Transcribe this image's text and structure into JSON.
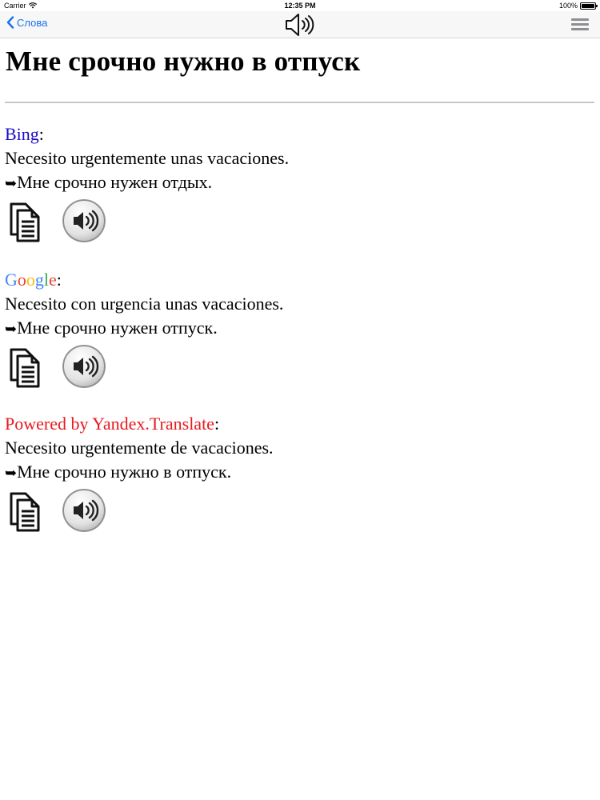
{
  "status": {
    "carrier": "Carrier",
    "time": "12:35 PM",
    "battery": "100%",
    "battery_level": 1.0
  },
  "nav": {
    "back_label": "Слова"
  },
  "page": {
    "title": "Мне срочно нужно в отпуск"
  },
  "arrow_glyph": "➥",
  "colon": ":",
  "sections": [
    {
      "provider": "Bing",
      "source": "Necesito urgentemente unas vacaciones.",
      "translation": "Мне срочно нужен отдых."
    },
    {
      "provider": "Google",
      "provider_letters": [
        "G",
        "o",
        "o",
        "g",
        "l",
        "e"
      ],
      "source": "Necesito con urgencia unas vacaciones.",
      "translation": "Мне срочно нужен отпуск."
    },
    {
      "provider": "Powered by Yandex.Translate",
      "source": "Necesito urgentemente de vacaciones.",
      "translation": "Мне срочно нужно в отпуск."
    }
  ],
  "colors": {
    "bing": "#1a0dc8",
    "yandex": "#e8191e",
    "link_blue": "#1a73e8",
    "google": [
      "#4285f4",
      "#ea4335",
      "#fbbc05",
      "#4285f4",
      "#34a853",
      "#ea4335"
    ]
  },
  "icons": {
    "back": "chevron-left-icon",
    "nav_speaker": "speaker-icon",
    "menu": "hamburger-menu-icon",
    "copy": "copy-documents-icon",
    "speak": "speaker-round-button-icon"
  }
}
